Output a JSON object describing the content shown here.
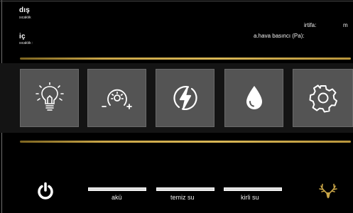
{
  "temperatures": {
    "outside": {
      "title": "dış",
      "sub": "sıcaklık"
    },
    "inside": {
      "title": "iç",
      "sub": "sıcaklık :"
    }
  },
  "readouts": {
    "altitude_label": "irtifa:",
    "altitude_unit": "m",
    "pressure_label": "a.hava basıncı (Pa):"
  },
  "tiles": [
    {
      "icon": "lightbulb-icon"
    },
    {
      "icon": "dimmer-icon"
    },
    {
      "icon": "lightning-icon"
    },
    {
      "icon": "water-drop-icon"
    },
    {
      "icon": "gear-icon"
    }
  ],
  "levels": {
    "battery": {
      "label": "akü",
      "fill": 1.0
    },
    "clean_water": {
      "label": "temiz su",
      "fill": 1.0
    },
    "grey_water": {
      "label": "kirli su",
      "fill": 1.0
    }
  },
  "colors": {
    "background": "#000000",
    "tile": "#545454",
    "accent_gold": "#c9a547",
    "logo": "#c9a547"
  },
  "icons": {
    "power": "power-icon",
    "logo": "deer-antler-logo"
  }
}
